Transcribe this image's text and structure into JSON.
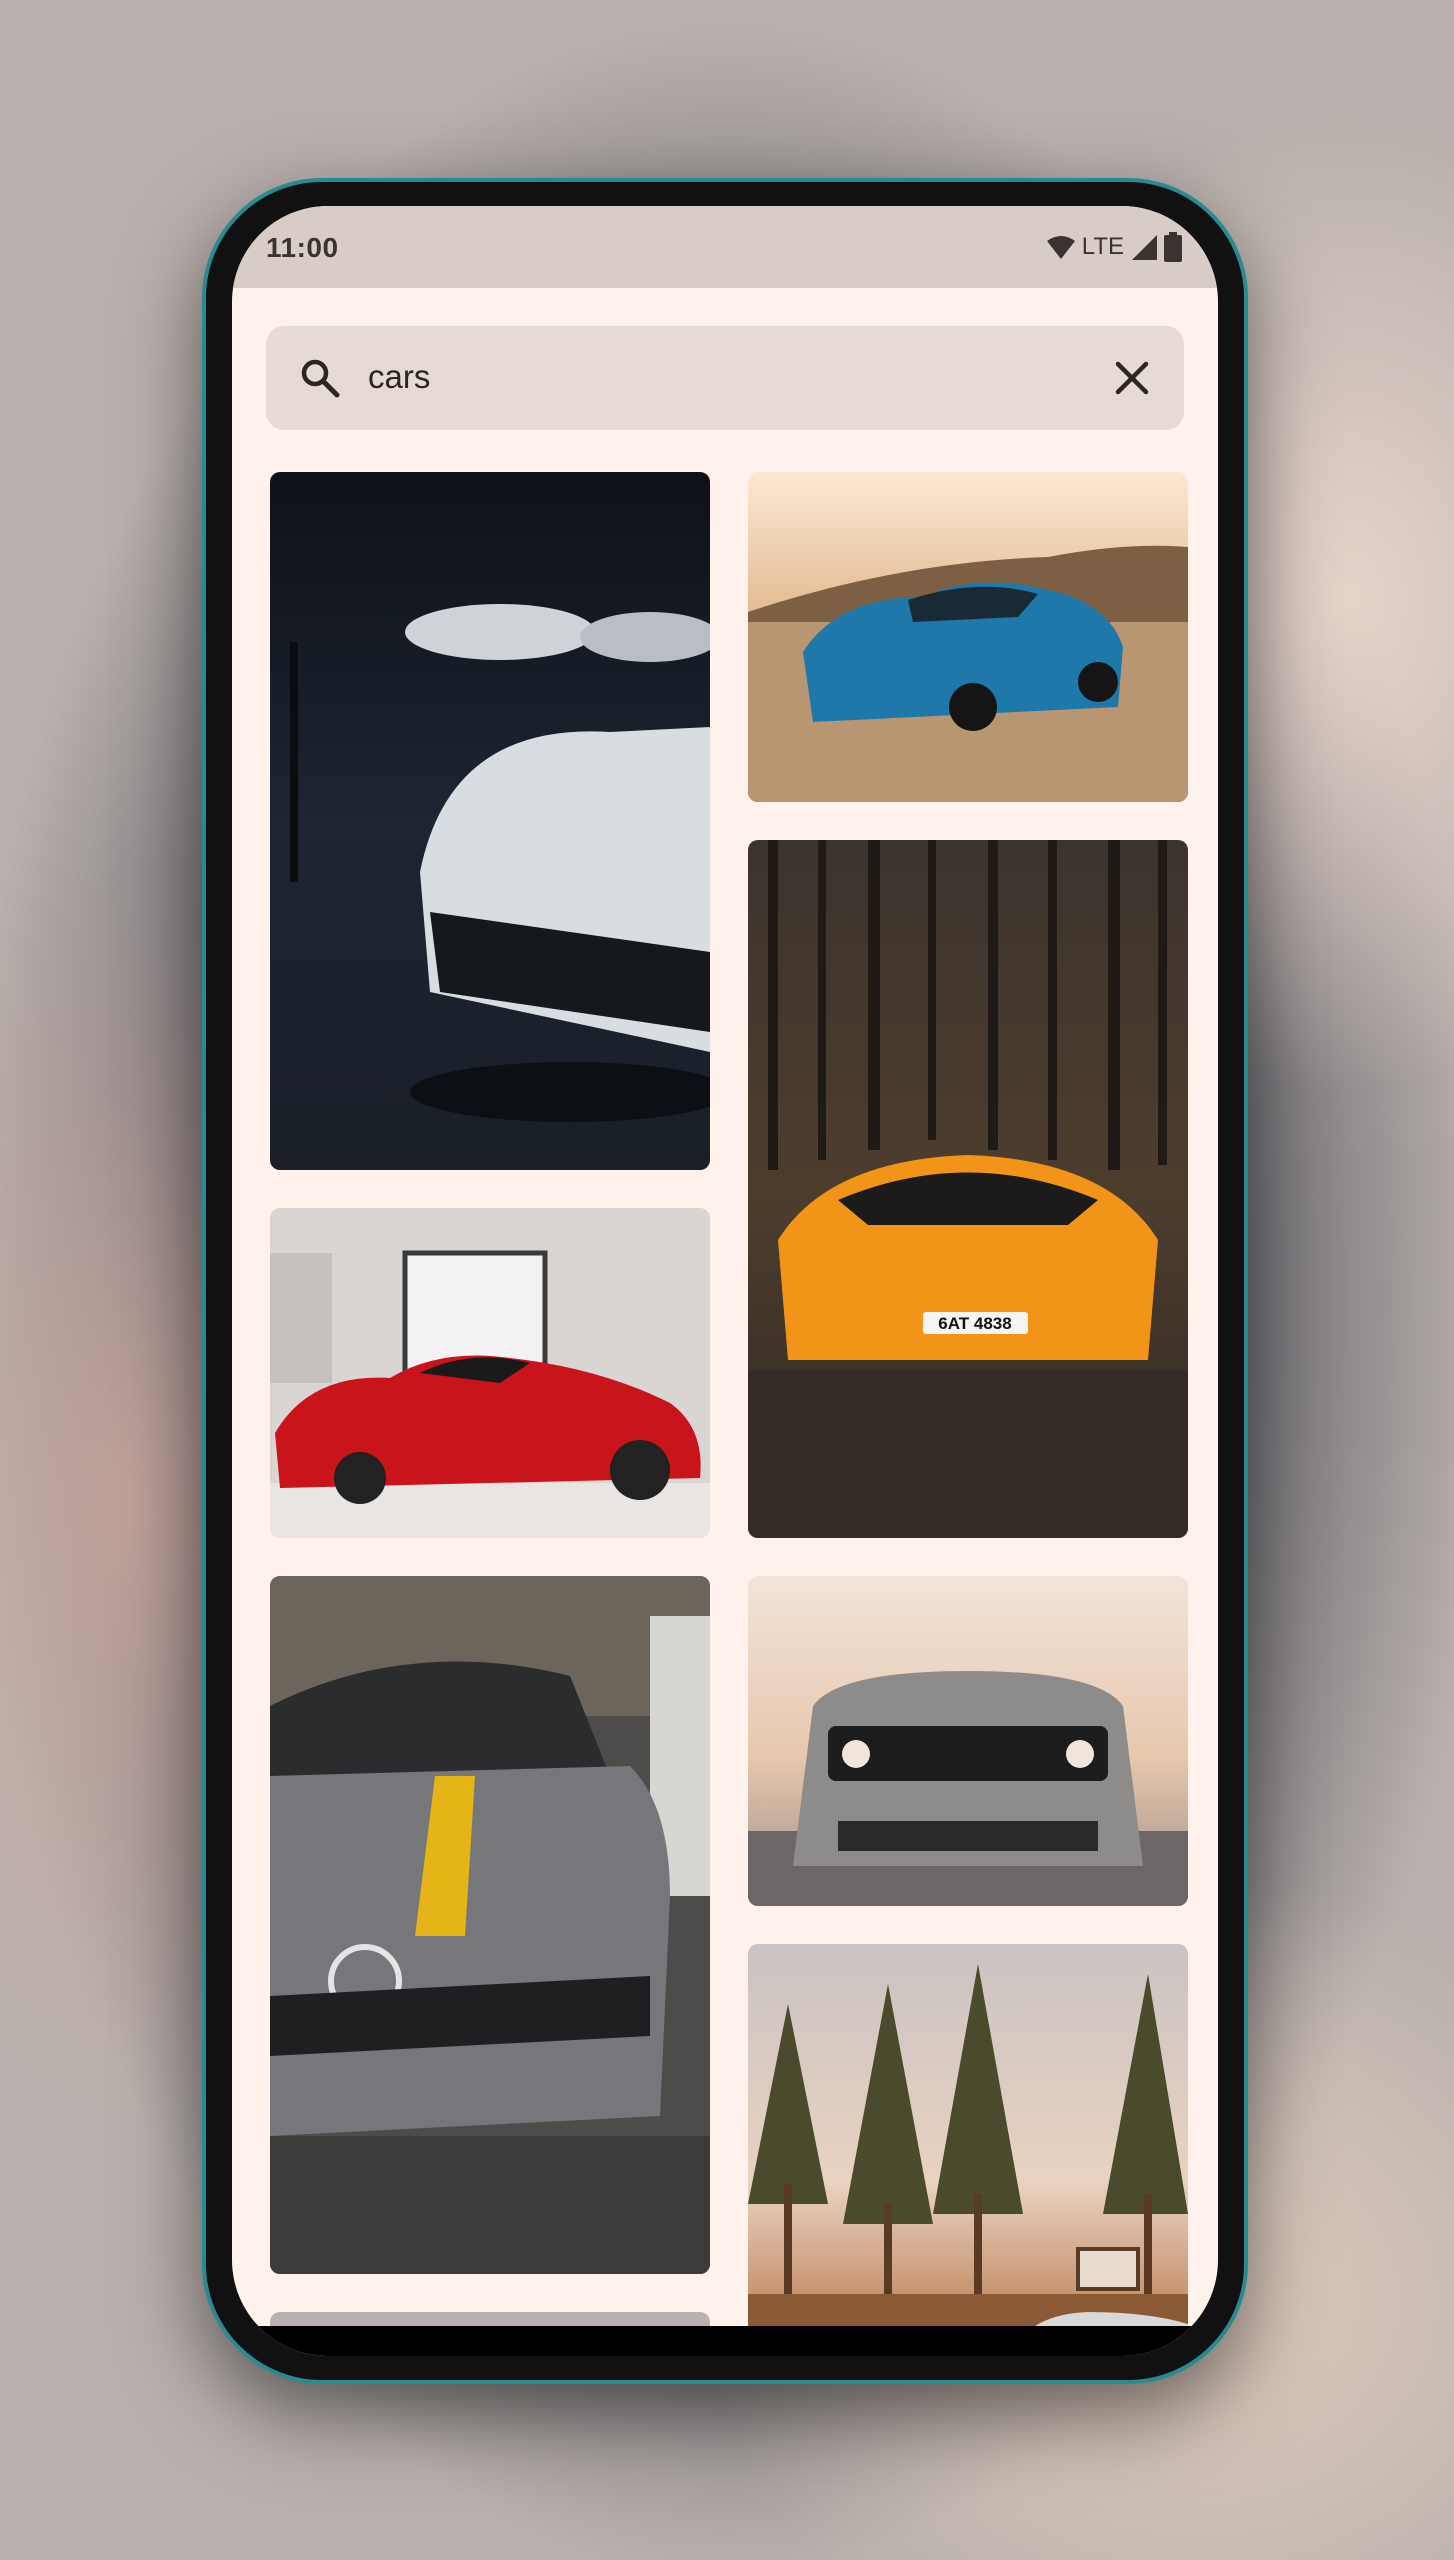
{
  "status_bar": {
    "time": "11:00",
    "network": "LTE"
  },
  "search": {
    "query": "cars",
    "icon": "search-icon",
    "clear_icon": "close-icon"
  },
  "results": [
    {
      "description": "white sports cars in dark garage"
    },
    {
      "description": "blue camaro in desert"
    },
    {
      "description": "orange lamborghini in forest"
    },
    {
      "description": "red ferrari in showroom"
    },
    {
      "description": "grey mercedes with yellow stripe"
    },
    {
      "description": "grey dodge challenger front"
    },
    {
      "description": "pine forest at sunset"
    },
    {
      "description": "partial image"
    }
  ],
  "colors": {
    "background": "#fff2ec",
    "search_bg": "#e6dad4",
    "status_bg": "#d8ccc7"
  }
}
